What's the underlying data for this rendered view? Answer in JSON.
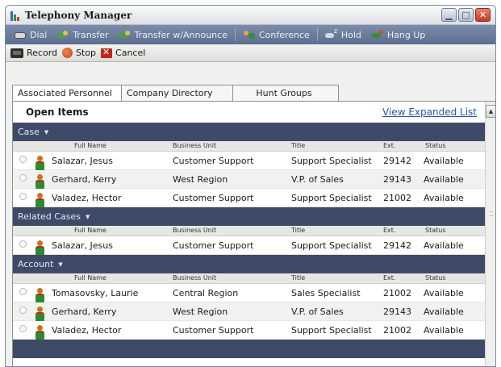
{
  "window": {
    "title": "Telephony Manager"
  },
  "toolbar_primary": [
    {
      "label": "Dial",
      "icon": "dial-icon"
    },
    {
      "label": "Transfer",
      "icon": "transfer-icon"
    },
    {
      "label": "Transfer w/Announce",
      "icon": "transfer-announce-icon"
    },
    {
      "label": "Conference",
      "icon": "conference-icon"
    },
    {
      "label": "Hold",
      "icon": "hold-icon"
    },
    {
      "label": "Hang Up",
      "icon": "hang-up-icon"
    }
  ],
  "toolbar_secondary": [
    {
      "label": "Record",
      "icon": "record-icon"
    },
    {
      "label": "Stop",
      "icon": "stop-icon"
    },
    {
      "label": "Cancel",
      "icon": "cancel-icon"
    }
  ],
  "tabs": [
    {
      "label": "Associated Personnel",
      "active": true
    },
    {
      "label": "Company Directory",
      "active": false
    },
    {
      "label": "Hunt Groups",
      "active": false
    }
  ],
  "panel": {
    "heading": "Open Items",
    "link": "View Expanded List"
  },
  "columns": {
    "name": "Full Name",
    "unit": "Business Unit",
    "title": "Title",
    "ext": "Ext.",
    "status": "Status"
  },
  "sections": [
    {
      "label": "Case",
      "rows": [
        {
          "name": "Salazar, Jesus",
          "unit": "Customer Support",
          "title": "Support Specialist",
          "ext": "29142",
          "status": "Available"
        },
        {
          "name": "Gerhard, Kerry",
          "unit": "West Region",
          "title": "V.P. of Sales",
          "ext": "29143",
          "status": "Available"
        },
        {
          "name": "Valadez, Hector",
          "unit": "Customer Support",
          "title": "Support Specialist",
          "ext": "21002",
          "status": "Available"
        }
      ]
    },
    {
      "label": "Related Cases",
      "rows": [
        {
          "name": "Salazar, Jesus",
          "unit": "Customer Support",
          "title": "Support Specialist",
          "ext": "29142",
          "status": "Available"
        }
      ]
    },
    {
      "label": "Account",
      "rows": [
        {
          "name": "Tomasovsky, Laurie",
          "unit": "Central Region",
          "title": "Sales Specialist",
          "ext": "21002",
          "status": "Available"
        },
        {
          "name": "Gerhard, Kerry",
          "unit": "West Region",
          "title": "V.P. of Sales",
          "ext": "29143",
          "status": "Available"
        },
        {
          "name": "Valadez, Hector",
          "unit": "Customer Support",
          "title": "Support Specialist",
          "ext": "21002",
          "status": "Available"
        }
      ]
    }
  ],
  "colors": {
    "toolbar": "#6b7b9c",
    "section_bar": "#3e4b68",
    "link": "#2a55b0",
    "close_button": "#c23c22"
  }
}
